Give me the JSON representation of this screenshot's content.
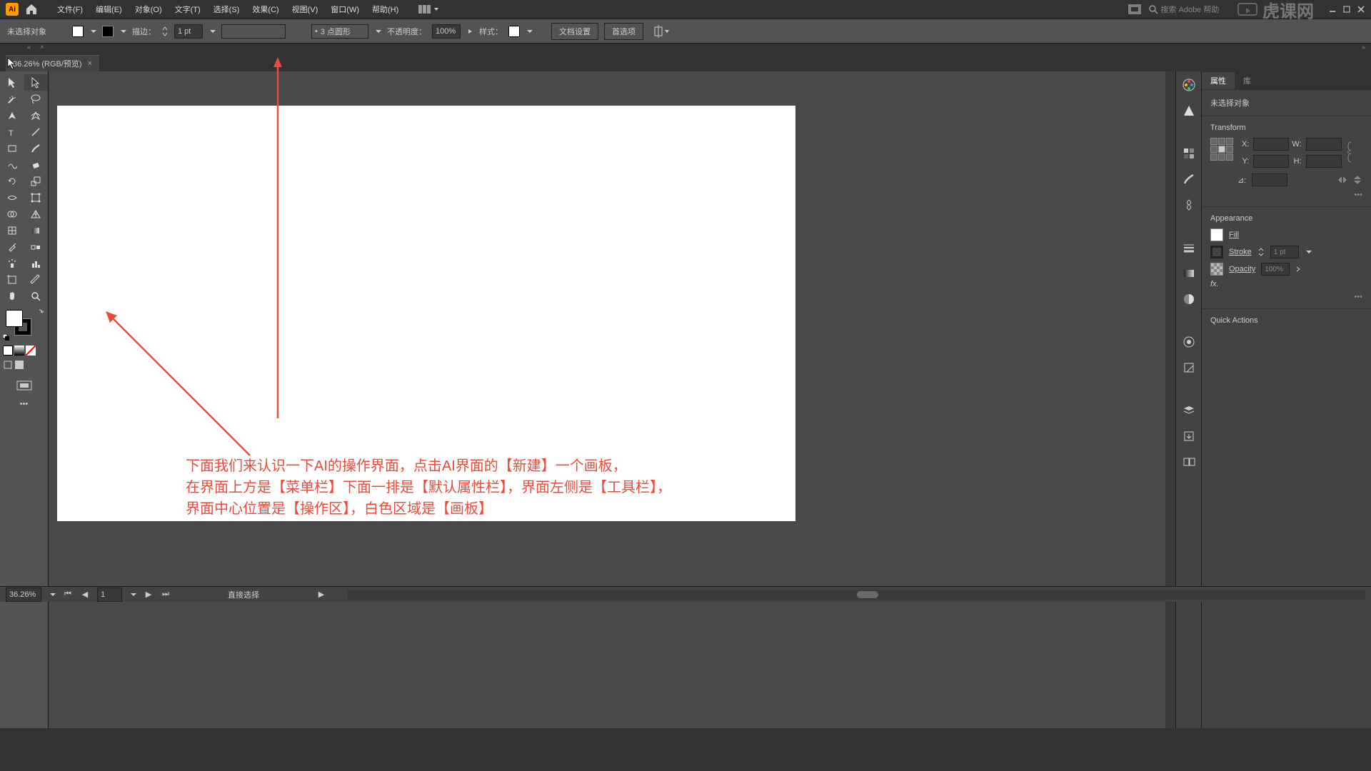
{
  "menu": {
    "file": "文件(F)",
    "edit": "编辑(E)",
    "object": "对象(O)",
    "type": "文字(T)",
    "select": "选择(S)",
    "effect": "效果(C)",
    "view": "视图(V)",
    "window": "窗口(W)",
    "help": "帮助(H)"
  },
  "search": {
    "placeholder": "搜索 Adobe 帮助"
  },
  "watermark": "虎课网",
  "control": {
    "no_selection": "未选择对象",
    "stroke_label": "描边：",
    "stroke_val": "1 pt",
    "brush_val": "3 点圆形",
    "opacity_label": "不透明度：",
    "opacity_val": "100%",
    "style_label": "样式：",
    "doc_setup": "文档设置",
    "prefs": "首选项"
  },
  "tab": {
    "title": "36.26% (RGB/预览)"
  },
  "annotation": {
    "line1": "下面我们来认识一下AI的操作界面，点击AI界面的【新建】一个画板，",
    "line2": "在界面上方是【菜单栏】下面一排是【默认属性栏】，界面左侧是【工具栏】，",
    "line3": "界面中心位置是【操作区】，白色区域是【画板】"
  },
  "panels": {
    "properties": "属性",
    "library": "库",
    "no_selection": "未选择对象",
    "transform": "Transform",
    "x": "X:",
    "y": "Y:",
    "w": "W:",
    "h": "H:",
    "angle": "⊿:",
    "appearance": "Appearance",
    "fill": "Fill",
    "stroke": "Stroke",
    "stroke_val": "1 pt",
    "opacity": "Opacity",
    "opacity_val": "100%",
    "fx": "fx.",
    "quick_actions": "Quick Actions"
  },
  "status": {
    "zoom": "36.26%",
    "artboard": "1",
    "tool": "直接选择"
  },
  "toolbox_icons": [
    [
      "selection",
      "direct-selection"
    ],
    [
      "magic-wand",
      "lasso"
    ],
    [
      "pen",
      "curvature"
    ],
    [
      "type",
      "line"
    ],
    [
      "rectangle",
      "paintbrush"
    ],
    [
      "shaper",
      "eraser"
    ],
    [
      "rotate",
      "scale"
    ],
    [
      "width",
      "free-transform"
    ],
    [
      "shape-builder",
      "perspective"
    ],
    [
      "mesh",
      "gradient"
    ],
    [
      "eyedropper",
      "blend"
    ],
    [
      "symbol-sprayer",
      "column-graph"
    ],
    [
      "artboard",
      "slice"
    ],
    [
      "hand",
      "zoom"
    ]
  ]
}
